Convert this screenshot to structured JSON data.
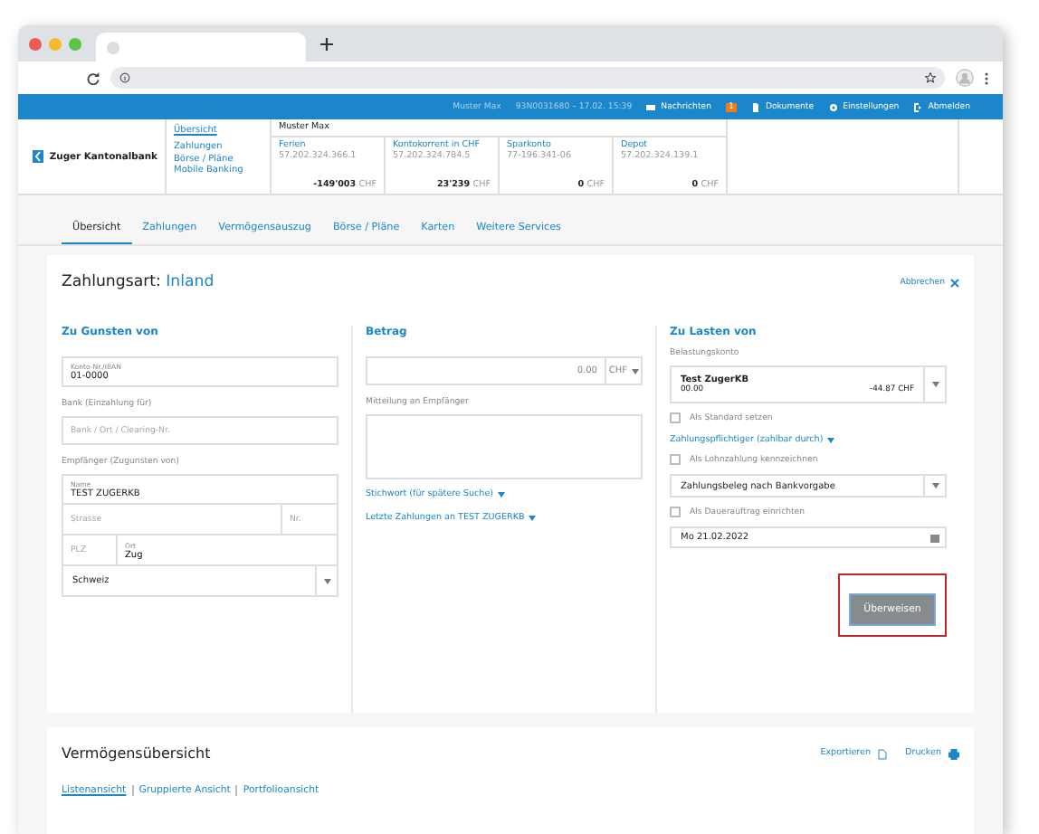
{
  "topbar": {
    "user": "Muster Max",
    "session": "93N0031680 – 17.02. 15:39",
    "links": [
      {
        "kind": "mail",
        "label": "Nachrichten",
        "badge": "1"
      },
      {
        "kind": "doc",
        "label": "Dokumente"
      },
      {
        "kind": "gear",
        "label": "Einstellungen"
      },
      {
        "kind": "logout",
        "label": "Abmelden"
      }
    ]
  },
  "bank": {
    "logo": "Zuger Kantonalbank",
    "menu": [
      {
        "label": "Übersicht",
        "selected": true
      },
      {
        "label": "Zahlungen",
        "selected": false
      },
      {
        "label": "Börse / Pläne",
        "selected": false
      },
      {
        "label": "Mobile Banking",
        "selected": false
      }
    ],
    "owner": "Muster Max",
    "accounts": [
      {
        "name": "Ferien",
        "number": "57.202.324.366.1",
        "amount": "-149'003",
        "currency": "CHF"
      },
      {
        "name": "Kontokorrent in CHF",
        "number": "57.202.324.784.5",
        "amount": "23'239",
        "currency": "CHF"
      },
      {
        "name": "Sparkonto",
        "number": "77-196.341-06",
        "amount": "0",
        "currency": "CHF"
      },
      {
        "name": "Depot",
        "number": "57.202.324.139.1",
        "amount": "0",
        "currency": "CHF"
      }
    ]
  },
  "tabs": [
    {
      "label": "Übersicht",
      "selected": true
    },
    {
      "label": "Zahlungen",
      "selected": false
    },
    {
      "label": "Vermögensauszug",
      "selected": false
    },
    {
      "label": "Börse / Pläne",
      "selected": false
    },
    {
      "label": "Karten",
      "selected": false
    },
    {
      "label": "Weitere Services",
      "selected": false
    }
  ],
  "payment": {
    "title": "Zahlungsart:",
    "type": "Inland",
    "cancel": "Abbrechen",
    "beneficiary": {
      "heading": "Zu Gunsten von",
      "account_label": "Konto-Nr./IBAN",
      "account_value": "01-0000",
      "bank_label": "Bank (Einzahlung für)",
      "bank_placeholder": "Bank / Ort / Clearing-Nr.",
      "recipient_label": "Empfänger (Zugunsten von)",
      "name_label": "Name",
      "name_value": "TEST ZUGERKB",
      "street_placeholder": "Strasse",
      "number_placeholder": "Nr.",
      "zip_placeholder": "PLZ",
      "city_label": "Ort",
      "city_value": "Zug",
      "country": "Schweiz"
    },
    "amount": {
      "heading": "Betrag",
      "value": "0.00",
      "currency": "CHF",
      "message_label": "Mitteilung an Empfänger",
      "links": [
        "Stichwort (für spätere Suche)",
        "Letzte Zahlungen an TEST ZUGERKB"
      ]
    },
    "debit": {
      "heading": "Zu Lasten von",
      "account_label": "Belastungskonto",
      "account_name": "Test ZugerKB",
      "account_number": "00.00",
      "account_balance": "-44.87 CHF",
      "options": [
        {
          "kind": "checkbox",
          "label": "Als Standard setzen",
          "checked": false
        },
        {
          "kind": "link",
          "label": "Zahlungspflichtiger (zahlbar durch)"
        },
        {
          "kind": "checkbox",
          "label": "Als Lohnzahlung kennzeichnen",
          "checked": false
        },
        {
          "kind": "select",
          "label": "Zahlungsbeleg nach Bankvorgabe"
        },
        {
          "kind": "checkbox",
          "label": "Als Dauerauftrag einrichten",
          "checked": false
        },
        {
          "kind": "date",
          "label": "Mo  21.02.2022"
        }
      ],
      "submit": "Überweisen",
      "submit_highlighted": true
    }
  },
  "overview": {
    "title": "Vermögensübersicht",
    "actions": [
      {
        "kind": "export",
        "label": "Exportieren"
      },
      {
        "kind": "print",
        "label": "Drucken"
      }
    ],
    "views": [
      {
        "label": "Listenansicht",
        "selected": true
      },
      {
        "label": "Gruppierte Ansicht",
        "selected": false
      },
      {
        "label": "Portfolioansicht",
        "selected": false
      }
    ]
  }
}
